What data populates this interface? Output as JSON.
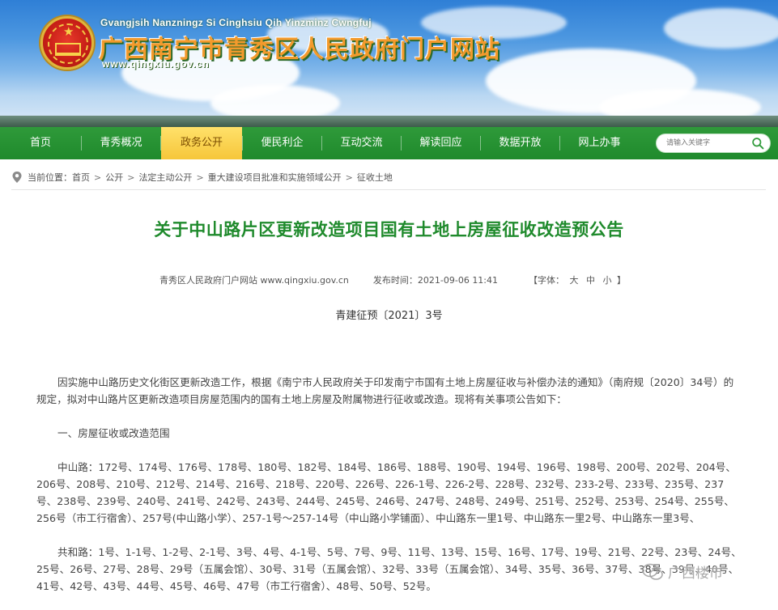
{
  "header": {
    "roman_name": "Gvangjsih Nanzningz Si Cinghsiu Qih Yinzminz Cwngfuj",
    "site_title": "广西南宁市青秀区人民政府门户网站",
    "site_url": "www.qingxiu.gov.cn"
  },
  "nav": {
    "items": [
      {
        "label": "首页"
      },
      {
        "label": "青秀概况"
      },
      {
        "label": "政务公开"
      },
      {
        "label": "便民利企"
      },
      {
        "label": "互动交流"
      },
      {
        "label": "解读回应"
      },
      {
        "label": "数据开放"
      },
      {
        "label": "网上办事"
      }
    ],
    "active_index": 2,
    "search_placeholder": "请输入关键字"
  },
  "breadcrumb": {
    "prefix": "当前位置：",
    "items": [
      "首页",
      "公开",
      "法定主动公开",
      "重大建设项目批准和实施领域公开",
      "征收土地"
    ],
    "separator": ">"
  },
  "article": {
    "title": "关于中山路片区更新改造项目国有土地上房屋征收改造预公告",
    "source": "青秀区人民政府门户网站 www.qingxiu.gov.cn",
    "publish_time": "发布时间：2021-09-06 11:41",
    "font_label_open": "【字体：",
    "font_sizes": [
      "大",
      "中",
      "小"
    ],
    "font_label_close": "】",
    "doc_number": "青建征预〔2021〕3号",
    "paragraphs": [
      "因实施中山路历史文化街区更新改造工作，根据《南宁市人民政府关于印发南宁市国有土地上房屋征收与补偿办法的通知》（南府规〔2020〕34号）的规定，拟对中山路片区更新改造项目房屋范围内的国有土地上房屋及附属物进行征收或改造。现将有关事项公告如下：",
      "一、房屋征收或改造范围",
      "中山路：172号、174号、176号、178号、180号、182号、184号、186号、188号、190号、194号、196号、198号、200号、202号、204号、206号、208号、210号、212号、214号、216号、218号、220号、226号、226-1号、226-2号、228号、232号、233-2号、233号、235号、237号、238号、239号、240号、241号、242号、243号、244号、245号、246号、247号、248号、249号、251号、252号、253号、254号、255号、256号（市工行宿舍）、257号(中山路小学）、257-1号～257-14号（中山路小学铺面）、中山路东一里1号、中山路东一里2号、中山路东一里3号、",
      "共和路：1号、1-1号、1-2号、2-1号、3号、4号、4-1号、5号、7号、9号、11号、13号、15号、16号、17号、19号、21号、22号、23号、24号、25号、26号、27号、28号、29号（五属会馆）、30号、31号（五属会馆）、32号、33号（五属会馆）、34号、35号、36号、37号、38号、39号、40号、41号、42号、43号、44号、45号、46号、47号（市工行宿舍）、48号、50号、52号。"
    ]
  },
  "watermark": {
    "text": "广西楼市"
  },
  "colors": {
    "nav_green": "#1f8a2c",
    "nav_active": "#f6c63a",
    "title_green": "#1f8a2c"
  }
}
